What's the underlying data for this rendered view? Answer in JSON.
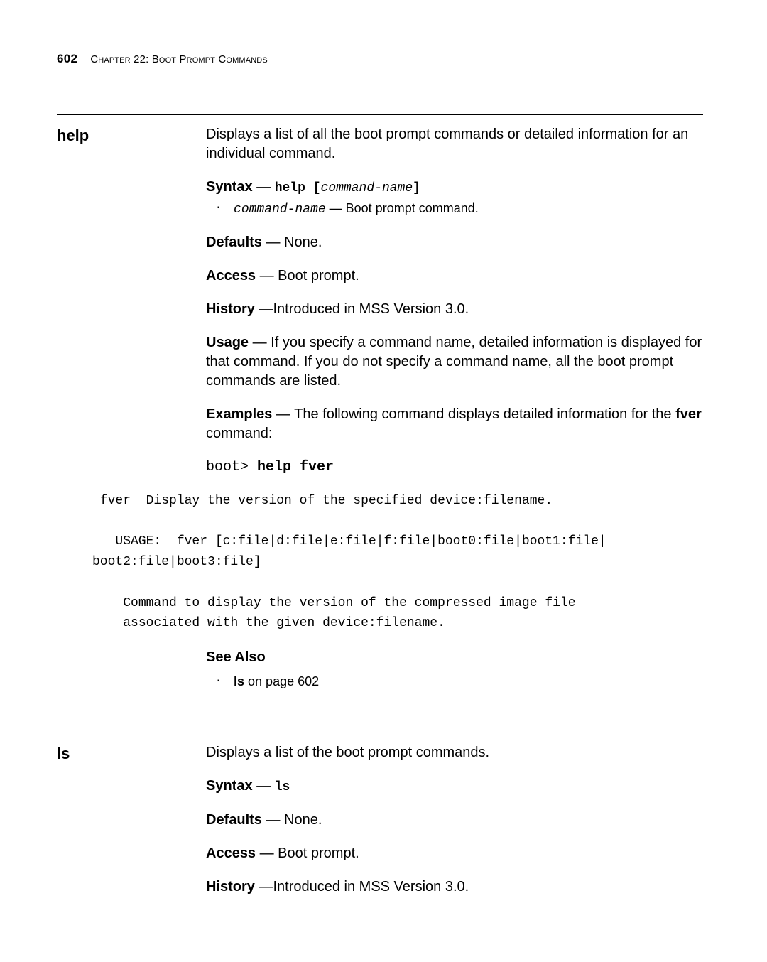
{
  "header": {
    "page_number": "602",
    "chapter_label": "Chapter 22: Boot Prompt Commands"
  },
  "help": {
    "name": "help",
    "description": "Displays a list of all the boot prompt commands or detailed information for an individual command.",
    "syntax_label": "Syntax",
    "syntax_prefix": "help [",
    "syntax_var": "command-name",
    "syntax_suffix": "]",
    "param_name": "command-name",
    "param_sep": " — ",
    "param_desc": "Boot prompt command.",
    "defaults_label": "Defaults",
    "defaults_value": " — None.",
    "access_label": "Access",
    "access_value": " — Boot prompt.",
    "history_label": "History",
    "history_value": " —Introduced in MSS Version 3.0.",
    "usage_label": "Usage",
    "usage_value": " — If you specify a command name, detailed information is displayed for that command. If you do not specify a command name, all the boot prompt commands are listed.",
    "examples_label": "Examples",
    "examples_intro": " — The following command displays detailed information for the ",
    "examples_cmd": "fver",
    "examples_outro": " command:",
    "example_prompt": "boot> ",
    "example_cmdline": "help fver",
    "example_output": " fver  Display the version of the specified device:filename.\n\n   USAGE:  fver [c:file|d:file|e:file|f:file|boot0:file|boot1:file|\nboot2:file|boot3:file]\n\n    Command to display the version of the compressed image file\n    associated with the given device:filename.",
    "see_also_label": "See Also",
    "see_also_item_cmd": "ls",
    "see_also_item_rest": " on page 602"
  },
  "ls": {
    "name": "ls",
    "description": "Displays a list of the boot prompt commands.",
    "syntax_label": "Syntax",
    "syntax_cmd": "ls",
    "defaults_label": "Defaults",
    "defaults_value": " — None.",
    "access_label": "Access",
    "access_value": " — Boot prompt.",
    "history_label": "History",
    "history_value": " —Introduced in MSS Version 3.0."
  }
}
